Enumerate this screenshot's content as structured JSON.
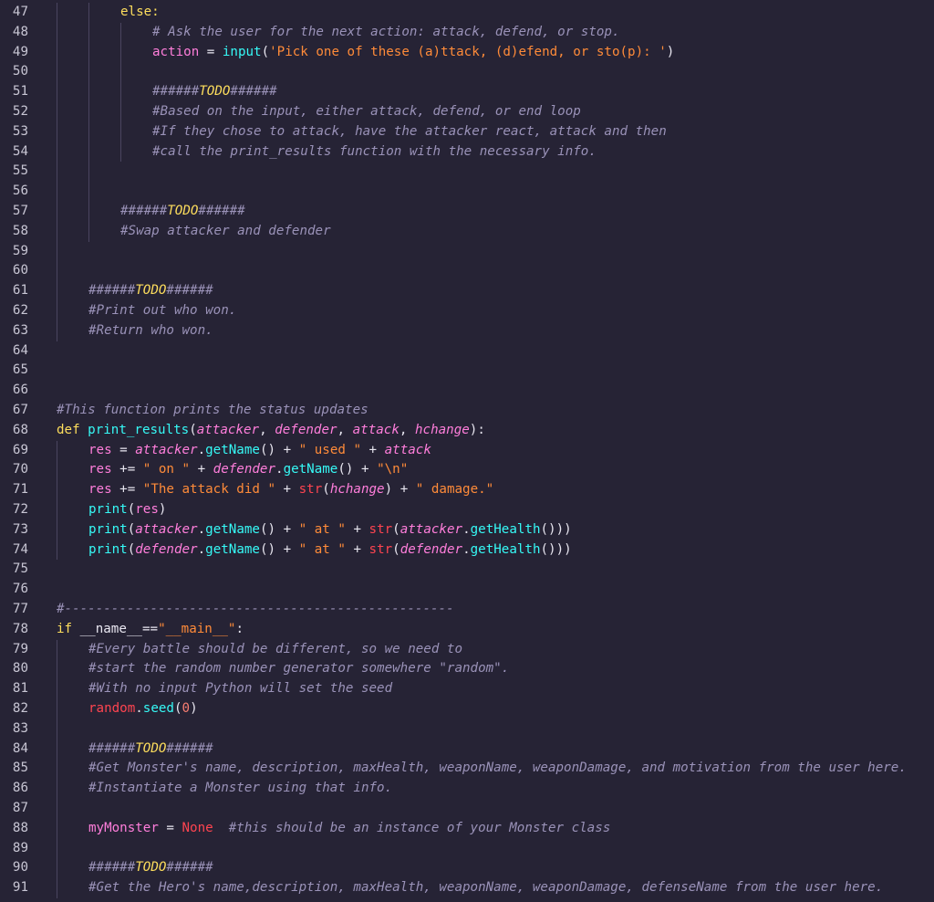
{
  "colors": {
    "background": "#262335",
    "keyword": "#fede5d",
    "comment": "#9a92b8",
    "string": "#ff8b39",
    "function": "#36f9f6",
    "parameter": "#ff7edb",
    "builtin": "#fe4450",
    "line_number": "#c8c6d4"
  },
  "lines": [
    {
      "n": "47",
      "i": 2,
      "t": [
        [
          "kw",
          "else:"
        ]
      ]
    },
    {
      "n": "48",
      "i": 3,
      "t": [
        [
          "cm",
          "# Ask the user for the next action: attack, defend, or stop."
        ]
      ]
    },
    {
      "n": "49",
      "i": 3,
      "t": [
        [
          "var",
          "action"
        ],
        [
          "op",
          " = "
        ],
        [
          "fn",
          "input"
        ],
        [
          "punc",
          "("
        ],
        [
          "str",
          "'Pick one of these (a)ttack, (d)efend, or sto(p): '"
        ],
        [
          "punc",
          ")"
        ]
      ]
    },
    {
      "n": "50",
      "i": 0,
      "t": []
    },
    {
      "n": "51",
      "i": 3,
      "t": [
        [
          "cm",
          "######"
        ],
        [
          "todo",
          "TODO"
        ],
        [
          "cm",
          "######"
        ]
      ]
    },
    {
      "n": "52",
      "i": 3,
      "t": [
        [
          "cm",
          "#Based on the input, either attack, defend, or end loop"
        ]
      ]
    },
    {
      "n": "53",
      "i": 3,
      "t": [
        [
          "cm",
          "#If they chose to attack, have the attacker react, attack and then"
        ]
      ]
    },
    {
      "n": "54",
      "i": 3,
      "t": [
        [
          "cm",
          "#call the print_results function with the necessary info."
        ]
      ]
    },
    {
      "n": "55",
      "i": 0,
      "t": []
    },
    {
      "n": "56",
      "i": 0,
      "t": []
    },
    {
      "n": "57",
      "i": 2,
      "t": [
        [
          "cm",
          "######"
        ],
        [
          "todo",
          "TODO"
        ],
        [
          "cm",
          "######"
        ]
      ]
    },
    {
      "n": "58",
      "i": 2,
      "t": [
        [
          "cm",
          "#Swap attacker and defender"
        ]
      ]
    },
    {
      "n": "59",
      "i": 0,
      "t": []
    },
    {
      "n": "60",
      "i": 0,
      "t": []
    },
    {
      "n": "61",
      "i": 1,
      "t": [
        [
          "cm",
          "######"
        ],
        [
          "todo",
          "TODO"
        ],
        [
          "cm",
          "######"
        ]
      ]
    },
    {
      "n": "62",
      "i": 1,
      "t": [
        [
          "cm",
          "#Print out who won."
        ]
      ]
    },
    {
      "n": "63",
      "i": 1,
      "t": [
        [
          "cm",
          "#Return who won."
        ]
      ]
    },
    {
      "n": "64",
      "i": 0,
      "t": []
    },
    {
      "n": "65",
      "i": 0,
      "t": []
    },
    {
      "n": "66",
      "i": 0,
      "t": []
    },
    {
      "n": "67",
      "i": 0,
      "t": [
        [
          "cm",
          "#This function prints the status updates"
        ]
      ]
    },
    {
      "n": "68",
      "i": 0,
      "t": [
        [
          "kw",
          "def "
        ],
        [
          "fn",
          "print_results"
        ],
        [
          "punc",
          "("
        ],
        [
          "param",
          "attacker"
        ],
        [
          "punc",
          ", "
        ],
        [
          "param",
          "defender"
        ],
        [
          "punc",
          ", "
        ],
        [
          "param",
          "attack"
        ],
        [
          "punc",
          ", "
        ],
        [
          "param",
          "hchange"
        ],
        [
          "punc",
          "):"
        ]
      ]
    },
    {
      "n": "69",
      "i": 1,
      "t": [
        [
          "var",
          "res"
        ],
        [
          "op",
          " = "
        ],
        [
          "param",
          "attacker"
        ],
        [
          "punc",
          "."
        ],
        [
          "fn",
          "getName"
        ],
        [
          "punc",
          "() "
        ],
        [
          "op",
          "+ "
        ],
        [
          "str",
          "\" used \""
        ],
        [
          "op",
          " + "
        ],
        [
          "param",
          "attack"
        ]
      ]
    },
    {
      "n": "70",
      "i": 1,
      "t": [
        [
          "var",
          "res"
        ],
        [
          "op",
          " += "
        ],
        [
          "str",
          "\" on \""
        ],
        [
          "op",
          " + "
        ],
        [
          "param",
          "defender"
        ],
        [
          "punc",
          "."
        ],
        [
          "fn",
          "getName"
        ],
        [
          "punc",
          "() "
        ],
        [
          "op",
          "+ "
        ],
        [
          "str",
          "\"\\n\""
        ]
      ]
    },
    {
      "n": "71",
      "i": 1,
      "t": [
        [
          "var",
          "res"
        ],
        [
          "op",
          " += "
        ],
        [
          "str",
          "\"The attack did \""
        ],
        [
          "op",
          " + "
        ],
        [
          "bi",
          "str"
        ],
        [
          "punc",
          "("
        ],
        [
          "param",
          "hchange"
        ],
        [
          "punc",
          ") "
        ],
        [
          "op",
          "+ "
        ],
        [
          "str",
          "\" damage.\""
        ]
      ]
    },
    {
      "n": "72",
      "i": 1,
      "t": [
        [
          "fn",
          "print"
        ],
        [
          "punc",
          "("
        ],
        [
          "var",
          "res"
        ],
        [
          "punc",
          ")"
        ]
      ]
    },
    {
      "n": "73",
      "i": 1,
      "t": [
        [
          "fn",
          "print"
        ],
        [
          "punc",
          "("
        ],
        [
          "param",
          "attacker"
        ],
        [
          "punc",
          "."
        ],
        [
          "fn",
          "getName"
        ],
        [
          "punc",
          "() "
        ],
        [
          "op",
          "+ "
        ],
        [
          "str",
          "\" at \""
        ],
        [
          "op",
          " + "
        ],
        [
          "bi",
          "str"
        ],
        [
          "punc",
          "("
        ],
        [
          "param",
          "attacker"
        ],
        [
          "punc",
          "."
        ],
        [
          "fn",
          "getHealth"
        ],
        [
          "punc",
          "()))"
        ]
      ]
    },
    {
      "n": "74",
      "i": 1,
      "t": [
        [
          "fn",
          "print"
        ],
        [
          "punc",
          "("
        ],
        [
          "param",
          "defender"
        ],
        [
          "punc",
          "."
        ],
        [
          "fn",
          "getName"
        ],
        [
          "punc",
          "() "
        ],
        [
          "op",
          "+ "
        ],
        [
          "str",
          "\" at \""
        ],
        [
          "op",
          " + "
        ],
        [
          "bi",
          "str"
        ],
        [
          "punc",
          "("
        ],
        [
          "param",
          "defender"
        ],
        [
          "punc",
          "."
        ],
        [
          "fn",
          "getHealth"
        ],
        [
          "punc",
          "()))"
        ]
      ]
    },
    {
      "n": "75",
      "i": 0,
      "t": []
    },
    {
      "n": "76",
      "i": 0,
      "t": []
    },
    {
      "n": "77",
      "i": 0,
      "t": [
        [
          "cm",
          "#--------------------------------------------------"
        ]
      ]
    },
    {
      "n": "78",
      "i": 0,
      "t": [
        [
          "kw",
          "if "
        ],
        [
          "name",
          "__name__"
        ],
        [
          "op",
          "=="
        ],
        [
          "str",
          "\"__main__\""
        ],
        [
          "punc",
          ":"
        ]
      ]
    },
    {
      "n": "79",
      "i": 1,
      "t": [
        [
          "cm",
          "#Every battle should be different, so we need to"
        ]
      ]
    },
    {
      "n": "80",
      "i": 1,
      "t": [
        [
          "cm",
          "#start the random number generator somewhere \"random\"."
        ]
      ]
    },
    {
      "n": "81",
      "i": 1,
      "t": [
        [
          "cm",
          "#With no input Python will set the seed"
        ]
      ]
    },
    {
      "n": "82",
      "i": 1,
      "t": [
        [
          "bi",
          "random"
        ],
        [
          "punc",
          "."
        ],
        [
          "fn",
          "seed"
        ],
        [
          "punc",
          "("
        ],
        [
          "num",
          "0"
        ],
        [
          "punc",
          ")"
        ]
      ]
    },
    {
      "n": "83",
      "i": 0,
      "t": []
    },
    {
      "n": "84",
      "i": 1,
      "t": [
        [
          "cm",
          "######"
        ],
        [
          "todo",
          "TODO"
        ],
        [
          "cm",
          "######"
        ]
      ]
    },
    {
      "n": "85",
      "i": 1,
      "t": [
        [
          "cm",
          "#Get Monster's name, description, maxHealth, weaponName, weaponDamage, and motivation from the user here."
        ]
      ]
    },
    {
      "n": "86",
      "i": 1,
      "t": [
        [
          "cm",
          "#Instantiate a Monster using that info."
        ]
      ]
    },
    {
      "n": "87",
      "i": 0,
      "t": []
    },
    {
      "n": "88",
      "i": 1,
      "t": [
        [
          "var",
          "myMonster"
        ],
        [
          "op",
          " = "
        ],
        [
          "bi",
          "None"
        ],
        [
          "txt",
          "  "
        ],
        [
          "cm",
          "#this should be an instance of your Monster class"
        ]
      ]
    },
    {
      "n": "89",
      "i": 0,
      "t": []
    },
    {
      "n": "90",
      "i": 1,
      "t": [
        [
          "cm",
          "######"
        ],
        [
          "todo",
          "TODO"
        ],
        [
          "cm",
          "######"
        ]
      ]
    },
    {
      "n": "91",
      "i": 1,
      "t": [
        [
          "cm",
          "#Get the Hero's name,description, maxHealth, weaponName, weaponDamage, defenseName from the user here."
        ]
      ]
    }
  ]
}
